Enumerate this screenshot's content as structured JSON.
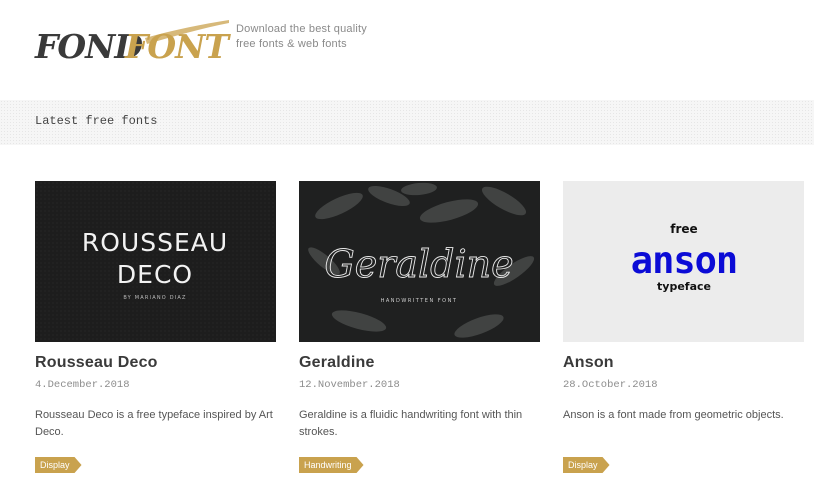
{
  "header": {
    "logo": {
      "part1": "FOND",
      "part2": "FONT",
      "color1": "#3a3a3a",
      "color2": "#c9a24e"
    },
    "tagline": [
      "Download the best quality",
      "free fonts & web fonts"
    ]
  },
  "section": {
    "title": "Latest free fonts"
  },
  "cards": [
    {
      "name": "Rousseau Deco",
      "date": "4.December.2018",
      "description": "Rousseau Deco is a free typeface inspired by Art Deco.",
      "tag": "Display",
      "preview": {
        "line1": "ROUSSEAU",
        "line2": "DECO",
        "byline": "BY MARIANO DIAZ"
      }
    },
    {
      "name": "Geraldine",
      "date": "12.November.2018",
      "description": "Geraldine is a fluidic handwriting font with thin strokes.",
      "tag": "Handwriting",
      "preview": {
        "script": "Geraldine",
        "subtitle": "HANDWRITTEN FONT"
      }
    },
    {
      "name": "Anson",
      "date": "28.October.2018",
      "description": "Anson is a font made from geometric objects.",
      "tag": "Display",
      "preview": {
        "top": "free",
        "main": "anson",
        "bottom": "typeface",
        "accent": "#0b0bd6"
      }
    }
  ],
  "colors": {
    "accent": "#c9a24e",
    "band": "#f6f6f6"
  }
}
